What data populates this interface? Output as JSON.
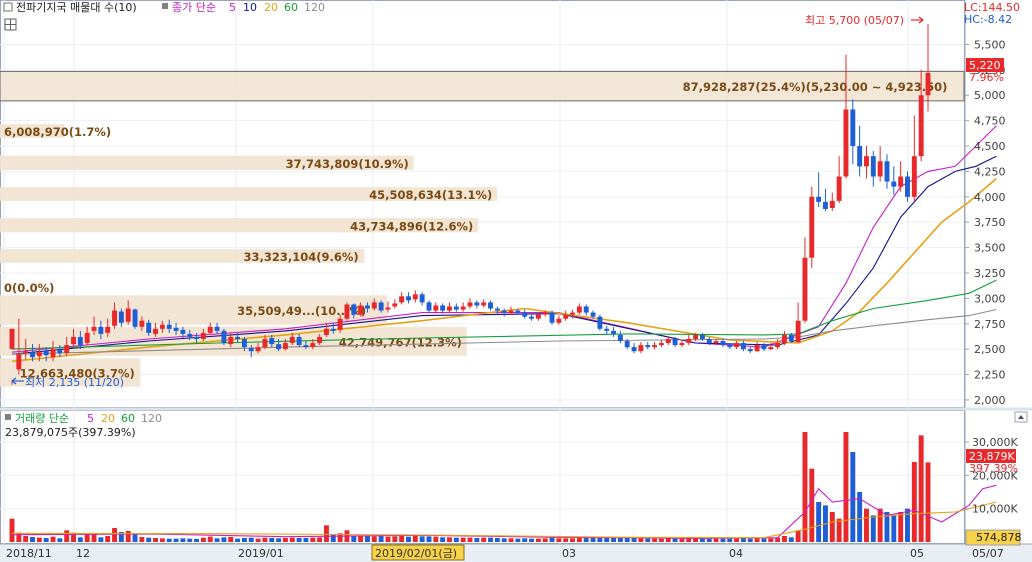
{
  "price_panel": {
    "title": "전파기지국 매물대 수(10)",
    "ma_label": "종가 단순",
    "periods": [
      "5",
      "10",
      "20",
      "60",
      "120"
    ],
    "lc": "LC:144.50",
    "hc": "HC:-8.42",
    "high_marker": "최고 5,700 (05/07)",
    "low_marker": "최저 2,135 (11/20)",
    "current_price": "5,220",
    "current_change": "7.96%"
  },
  "volume_panel": {
    "title": "거래량 단순",
    "periods": [
      "5",
      "20",
      "60",
      "120"
    ],
    "summary": "23,879,075주(397.39%)",
    "current_volume": "23,879K",
    "current_ratio": "397.39%",
    "volume_box": "574,878"
  },
  "x_axis": {
    "labels": [
      "2018/11",
      "12",
      "2019/01",
      "2019/02/01(금)",
      "03",
      "04",
      "05"
    ],
    "right_label": "05/07"
  },
  "colors": {
    "up": "#e8282b",
    "down": "#1f5fd6",
    "ma5": "#c81ec8",
    "ma10": "#14148c",
    "ma20": "#e6a214",
    "ma60": "#14a03c",
    "ma120": "#8c8c8c",
    "volume_bar": "#f2e4d2",
    "volume_bar_highlight": "#f3e6d6",
    "label_text": "#7a4a14"
  },
  "chart_data": {
    "type": "candlestick",
    "x_start": "2018-11-19",
    "x_end": "2019-05-07",
    "price_ylim": [
      1950,
      5800
    ],
    "price_ticks": [
      "5,500",
      "5,250",
      "5,000",
      "4,750",
      "4,500",
      "4,250",
      "4,000",
      "3,750",
      "3,500",
      "3,250",
      "3,000",
      "2,750",
      "2,500",
      "2,250",
      "2,000"
    ],
    "volume_ylim": [
      0,
      36000
    ],
    "volume_ticks": [
      "30,000K",
      "20,000K",
      "10,000K"
    ],
    "candles": [
      [
        2500,
        2700,
        2180,
        2150,
        "7000K"
      ],
      [
        2300,
        2450,
        2800,
        2250,
        "2800K"
      ],
      [
        2460,
        2480,
        2600,
        2400,
        "1800K"
      ],
      [
        2470,
        2420,
        2550,
        2380,
        "1500K"
      ],
      [
        2430,
        2470,
        2550,
        2380,
        "1300K"
      ],
      [
        2480,
        2440,
        2520,
        2380,
        "1200K"
      ],
      [
        2420,
        2500,
        2580,
        2380,
        "1600K"
      ],
      [
        2490,
        2460,
        2540,
        2420,
        "1100K"
      ],
      [
        2460,
        2540,
        2620,
        2430,
        "3500K"
      ],
      [
        2550,
        2620,
        2700,
        2520,
        "2800K"
      ],
      [
        2620,
        2540,
        2680,
        2500,
        "1400K"
      ],
      [
        2560,
        2660,
        2720,
        2540,
        "2400K"
      ],
      [
        2680,
        2720,
        2820,
        2640,
        "2500K"
      ],
      [
        2720,
        2650,
        2780,
        2600,
        "1400K"
      ],
      [
        2660,
        2720,
        2800,
        2620,
        "1800K"
      ],
      [
        2730,
        2880,
        2960,
        2700,
        "4200K"
      ],
      [
        2870,
        2760,
        2900,
        2720,
        "3000K"
      ],
      [
        2770,
        2900,
        2980,
        2740,
        "3300K"
      ],
      [
        2890,
        2720,
        2900,
        2700,
        "2600K"
      ],
      [
        2720,
        2780,
        2820,
        2680,
        "1500K"
      ],
      [
        2760,
        2660,
        2790,
        2630,
        "1300K"
      ],
      [
        2650,
        2700,
        2760,
        2620,
        "1200K"
      ],
      [
        2700,
        2740,
        2780,
        2660,
        "1100K"
      ],
      [
        2740,
        2700,
        2790,
        2660,
        "1000K"
      ],
      [
        2710,
        2680,
        2760,
        2640,
        "1000K"
      ],
      [
        2690,
        2650,
        2720,
        2610,
        "1100K"
      ],
      [
        2650,
        2620,
        2690,
        2590,
        "1000K"
      ],
      [
        2620,
        2600,
        2660,
        2560,
        "900K"
      ],
      [
        2600,
        2660,
        2700,
        2580,
        "1300K"
      ],
      [
        2660,
        2720,
        2760,
        2640,
        "1600K"
      ],
      [
        2720,
        2680,
        2760,
        2650,
        "1100K"
      ],
      [
        2680,
        2560,
        2700,
        2540,
        "1400K"
      ],
      [
        2550,
        2620,
        2660,
        2520,
        "1500K"
      ],
      [
        2620,
        2600,
        2660,
        2570,
        "1000K"
      ],
      [
        2600,
        2520,
        2620,
        2480,
        "1200K"
      ],
      [
        2510,
        2480,
        2540,
        2420,
        "1300K"
      ],
      [
        2480,
        2520,
        2560,
        2460,
        "1000K"
      ],
      [
        2520,
        2600,
        2640,
        2500,
        "1300K"
      ],
      [
        2610,
        2550,
        2640,
        2520,
        "1200K"
      ],
      [
        2550,
        2500,
        2600,
        2480,
        "1100K"
      ],
      [
        2500,
        2560,
        2600,
        2490,
        "1200K"
      ],
      [
        2560,
        2620,
        2660,
        2540,
        "1300K"
      ],
      [
        2620,
        2540,
        2650,
        2520,
        "1200K"
      ],
      [
        2540,
        2520,
        2580,
        2500,
        "1200K"
      ],
      [
        2520,
        2560,
        2600,
        2500,
        "1300K"
      ],
      [
        2560,
        2620,
        2650,
        2540,
        "1400K"
      ],
      [
        2640,
        2700,
        2760,
        2620,
        "5000K"
      ],
      [
        2700,
        2680,
        2760,
        2650,
        "2400K"
      ],
      [
        2690,
        2800,
        2840,
        2660,
        "2600K"
      ],
      [
        2800,
        2940,
        2960,
        2780,
        "3500K"
      ],
      [
        2940,
        2840,
        2950,
        2800,
        "1900K"
      ],
      [
        2840,
        2930,
        2960,
        2820,
        "1800K"
      ],
      [
        2930,
        2900,
        2960,
        2860,
        "1800K"
      ],
      [
        2900,
        2960,
        3000,
        2880,
        "1700K"
      ],
      [
        2960,
        2880,
        2980,
        2860,
        "2000K"
      ],
      [
        2890,
        2910,
        2970,
        2860,
        "1600K"
      ],
      [
        2920,
        2950,
        2990,
        2900,
        "1700K"
      ],
      [
        2960,
        3020,
        3060,
        2940,
        "2200K"
      ],
      [
        3020,
        2980,
        3060,
        2950,
        "1600K"
      ],
      [
        2990,
        3040,
        3080,
        2960,
        "2200K"
      ],
      [
        3040,
        2960,
        3060,
        2930,
        "1700K"
      ],
      [
        2960,
        2880,
        2980,
        2860,
        "1700K"
      ],
      [
        2880,
        2930,
        2960,
        2860,
        "1600K"
      ],
      [
        2930,
        2880,
        2950,
        2850,
        "1400K"
      ],
      [
        2880,
        2920,
        2960,
        2860,
        "1400K"
      ],
      [
        2920,
        2890,
        2950,
        2870,
        "1300K"
      ],
      [
        2890,
        2920,
        2960,
        2870,
        "1300K"
      ],
      [
        2920,
        2960,
        3000,
        2900,
        "1300K"
      ],
      [
        2960,
        2930,
        2980,
        2900,
        "1200K"
      ],
      [
        2930,
        2960,
        2990,
        2910,
        "1300K"
      ],
      [
        2960,
        2900,
        2980,
        2880,
        "1300K"
      ],
      [
        2900,
        2880,
        2920,
        2840,
        "1200K"
      ],
      [
        2880,
        2860,
        2900,
        2820,
        "1100K"
      ],
      [
        2860,
        2880,
        2920,
        2840,
        "1100K"
      ],
      [
        2880,
        2860,
        2900,
        2840,
        "1000K"
      ],
      [
        2860,
        2820,
        2890,
        2800,
        "1100K"
      ],
      [
        2820,
        2800,
        2850,
        2780,
        "1000K"
      ],
      [
        2800,
        2840,
        2860,
        2780,
        "1000K"
      ],
      [
        2840,
        2860,
        2880,
        2820,
        "1100K"
      ],
      [
        2860,
        2760,
        2880,
        2740,
        "1300K"
      ],
      [
        2760,
        2800,
        2830,
        2740,
        "1100K"
      ],
      [
        2800,
        2840,
        2880,
        2780,
        "1100K"
      ],
      [
        2840,
        2860,
        2890,
        2800,
        "1100K"
      ],
      [
        2860,
        2920,
        2950,
        2840,
        "1400K"
      ],
      [
        2920,
        2860,
        2940,
        2830,
        "1300K"
      ],
      [
        2860,
        2820,
        2880,
        2800,
        "1200K"
      ],
      [
        2820,
        2700,
        2840,
        2680,
        "1500K"
      ],
      [
        2700,
        2680,
        2730,
        2640,
        "1300K"
      ],
      [
        2680,
        2650,
        2720,
        2620,
        "1200K"
      ],
      [
        2640,
        2580,
        2680,
        2560,
        "1300K"
      ],
      [
        2580,
        2520,
        2600,
        2500,
        "1400K"
      ],
      [
        2520,
        2480,
        2560,
        2460,
        "1200K"
      ],
      [
        2480,
        2540,
        2570,
        2460,
        "1100K"
      ],
      [
        2540,
        2520,
        2570,
        2500,
        "1000K"
      ],
      [
        2520,
        2540,
        2570,
        2500,
        "1000K"
      ],
      [
        2540,
        2560,
        2590,
        2520,
        "1000K"
      ],
      [
        2560,
        2600,
        2620,
        2540,
        "1100K"
      ],
      [
        2600,
        2540,
        2620,
        2520,
        "1000K"
      ],
      [
        2540,
        2560,
        2590,
        2520,
        "1000K"
      ],
      [
        2560,
        2600,
        2640,
        2540,
        "1100K"
      ],
      [
        2600,
        2640,
        2660,
        2580,
        "1200K"
      ],
      [
        2640,
        2600,
        2660,
        2580,
        "1100K"
      ],
      [
        2600,
        2560,
        2620,
        2540,
        "1000K"
      ],
      [
        2560,
        2580,
        2600,
        2540,
        "1000K"
      ],
      [
        2580,
        2540,
        2600,
        2520,
        "1000K"
      ],
      [
        2540,
        2520,
        2560,
        2500,
        "1000K"
      ],
      [
        2520,
        2560,
        2580,
        2500,
        "1000K"
      ],
      [
        2560,
        2500,
        2580,
        2480,
        "1100K"
      ],
      [
        2500,
        2480,
        2520,
        2460,
        "1000K"
      ],
      [
        2480,
        2540,
        2570,
        2470,
        "1200K"
      ],
      [
        2540,
        2500,
        2560,
        2480,
        "1100K"
      ],
      [
        2500,
        2520,
        2560,
        2490,
        "1100K"
      ],
      [
        2520,
        2560,
        2600,
        2500,
        "1300K"
      ],
      [
        2560,
        2640,
        2680,
        2540,
        "1800K"
      ],
      [
        2640,
        2580,
        2660,
        2560,
        "1400K"
      ],
      [
        2570,
        2780,
        2960,
        2560,
        "3500K"
      ],
      [
        2780,
        3400,
        3600,
        2760,
        "33000K"
      ],
      [
        3400,
        4000,
        4100,
        3300,
        "22000K"
      ],
      [
        4000,
        3950,
        4240,
        3900,
        "12000K"
      ],
      [
        3950,
        3880,
        4080,
        3860,
        "11000K"
      ],
      [
        3890,
        3960,
        4040,
        3860,
        "9000K"
      ],
      [
        3960,
        4200,
        4400,
        3940,
        "7000K"
      ],
      [
        4200,
        4860,
        5400,
        4180,
        "33000K"
      ],
      [
        4860,
        4500,
        4960,
        4320,
        "27000K"
      ],
      [
        4500,
        4300,
        4700,
        4200,
        "15000K"
      ],
      [
        4300,
        4400,
        4500,
        4180,
        "10000K"
      ],
      [
        4400,
        4200,
        4450,
        4100,
        "8000K"
      ],
      [
        4200,
        4350,
        4500,
        4150,
        "10000K"
      ],
      [
        4350,
        4150,
        4420,
        4080,
        "9000K"
      ],
      [
        4150,
        4100,
        4300,
        4020,
        "8000K"
      ],
      [
        4100,
        4200,
        4350,
        4050,
        "9000K"
      ],
      [
        4200,
        4000,
        4250,
        3950,
        "10000K"
      ],
      [
        4000,
        4400,
        4800,
        3950,
        "24000K"
      ],
      [
        4400,
        5000,
        5250,
        4350,
        "32000K"
      ],
      [
        5000,
        5220,
        5700,
        4840,
        "23879K"
      ]
    ],
    "ma_lines": {
      "5": [
        [
          0,
          2470
        ],
        [
          20,
          2600
        ],
        [
          40,
          2700
        ],
        [
          60,
          2860
        ],
        [
          80,
          2860
        ],
        [
          100,
          2560
        ],
        [
          110,
          2520
        ],
        [
          118,
          2720
        ],
        [
          122,
          3150
        ],
        [
          126,
          3700
        ],
        [
          130,
          4100
        ],
        [
          134,
          4250
        ],
        [
          138,
          4300
        ],
        [
          141,
          4500
        ],
        [
          144,
          4700
        ]
      ],
      "10": [
        [
          0,
          2450
        ],
        [
          20,
          2580
        ],
        [
          40,
          2680
        ],
        [
          60,
          2830
        ],
        [
          80,
          2850
        ],
        [
          100,
          2560
        ],
        [
          112,
          2540
        ],
        [
          118,
          2640
        ],
        [
          122,
          2950
        ],
        [
          126,
          3300
        ],
        [
          130,
          3800
        ],
        [
          134,
          4100
        ],
        [
          138,
          4250
        ],
        [
          141,
          4300
        ],
        [
          144,
          4400
        ]
      ],
      "20": [
        [
          0,
          2380
        ],
        [
          20,
          2520
        ],
        [
          40,
          2640
        ],
        [
          60,
          2780
        ],
        [
          75,
          2900
        ],
        [
          90,
          2760
        ],
        [
          105,
          2590
        ],
        [
          115,
          2560
        ],
        [
          120,
          2680
        ],
        [
          124,
          2870
        ],
        [
          128,
          3150
        ],
        [
          132,
          3450
        ],
        [
          136,
          3750
        ],
        [
          140,
          3950
        ],
        [
          144,
          4180
        ]
      ],
      "60": [
        [
          0,
          2500
        ],
        [
          30,
          2560
        ],
        [
          60,
          2610
        ],
        [
          90,
          2650
        ],
        [
          110,
          2640
        ],
        [
          115,
          2650
        ],
        [
          120,
          2780
        ],
        [
          126,
          2900
        ],
        [
          134,
          2980
        ],
        [
          140,
          3050
        ],
        [
          144,
          3180
        ]
      ],
      "120": [
        [
          0,
          2450
        ],
        [
          40,
          2520
        ],
        [
          80,
          2580
        ],
        [
          110,
          2600
        ],
        [
          115,
          2620
        ],
        [
          120,
          2680
        ],
        [
          126,
          2730
        ],
        [
          134,
          2790
        ],
        [
          140,
          2830
        ],
        [
          144,
          2890
        ]
      ]
    },
    "volume_profile": [
      {
        "label": "87,928,287(25.4%)(5,230.00 ~ 4,923.50)",
        "from": 4925,
        "to": 5235,
        "share": 25.4
      },
      {
        "label": "6,008,970(1.7%)",
        "from": 4560,
        "to": 4715,
        "share": 1.7
      },
      {
        "label": "37,743,809(10.9%)",
        "from": 4245,
        "to": 4405,
        "share": 10.9
      },
      {
        "label": "45,508,634(13.1%)",
        "from": 3940,
        "to": 4095,
        "share": 13.1
      },
      {
        "label": "43,734,896(12.6%)",
        "from": 3630,
        "to": 3790,
        "share": 12.6
      },
      {
        "label": "33,323,104(9.6%)",
        "from": 3330,
        "to": 3485,
        "share": 9.6
      },
      {
        "label": "0(0.0%)",
        "from": 3025,
        "to": 3180,
        "share": 0.0
      },
      {
        "label": "35,509,49...(10...%)",
        "from": 2720,
        "to": 3030,
        "share": 10.2
      },
      {
        "label": "42,749,767(12.3%)",
        "from": 2415,
        "to": 2720,
        "share": 12.3
      },
      {
        "label": "12,663,480(3.7%)",
        "from": 2110,
        "to": 2410,
        "share": 3.7
      }
    ],
    "volume_ma": {
      "5": [
        [
          0,
          2200
        ],
        [
          20,
          2400
        ],
        [
          40,
          1600
        ],
        [
          60,
          2000
        ],
        [
          80,
          1400
        ],
        [
          100,
          1100
        ],
        [
          112,
          1300
        ],
        [
          116,
          9000
        ],
        [
          118,
          16000
        ],
        [
          120,
          12000
        ],
        [
          124,
          13000
        ],
        [
          128,
          8000
        ],
        [
          132,
          9500
        ],
        [
          136,
          6000
        ],
        [
          140,
          11000
        ],
        [
          142,
          16000
        ],
        [
          144,
          17000
        ]
      ],
      "20": [
        [
          0,
          2600
        ],
        [
          30,
          2500
        ],
        [
          60,
          2100
        ],
        [
          90,
          1400
        ],
        [
          110,
          1300
        ],
        [
          116,
          3800
        ],
        [
          120,
          6000
        ],
        [
          126,
          7500
        ],
        [
          132,
          8500
        ],
        [
          138,
          9000
        ],
        [
          144,
          12000
        ]
      ]
    }
  }
}
